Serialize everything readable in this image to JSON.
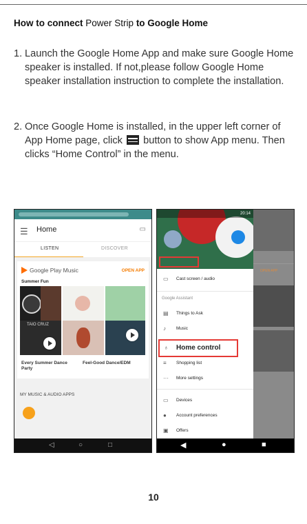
{
  "heading": {
    "prefix": "How to connect",
    "device": "Power Strip",
    "suffix": "to Google Home"
  },
  "steps": [
    {
      "num": "1.",
      "text": "Launch the Google Home App and make sure Google Home speaker is installed. If not,please follow Google Home speaker installation instruction to complete the installation."
    },
    {
      "num": "2.",
      "text_before": "Once Google Home is installed, in the upper left corner of App Home page, click",
      "icon": "menu-icon",
      "text_after": "button to show App menu. Then clicks “Home Control” in the menu."
    }
  ],
  "screenshot_home": {
    "title": "Home",
    "tabs": [
      "LISTEN",
      "DISCOVER"
    ],
    "card_title": "Google Play Music",
    "open_app": "OPEN APP",
    "section": "Summer Fun",
    "album_text_1": "TAIO CRUZ",
    "captions": [
      "Every Summer Dance Party",
      "Feel-Good Dance/EDM"
    ],
    "my_music": "MY MUSIC & AUDIO APPS"
  },
  "screenshot_menu": {
    "status_time": "20:14",
    "bg_open_app": "OPEN APP",
    "items_top": [
      {
        "icon": "cast-icon",
        "label": "Cast screen / audio"
      }
    ],
    "section": "Google Assistant",
    "items_assistant": [
      {
        "icon": "things-icon",
        "label": "Things to Ask"
      },
      {
        "icon": "music-icon",
        "label": "Music"
      }
    ],
    "highlighted": {
      "icon": "bulb-icon",
      "label": "Home control"
    },
    "items_more": [
      {
        "icon": "list-icon",
        "label": "Shopping list"
      },
      {
        "icon": "more-icon",
        "label": "More settings"
      }
    ],
    "items_bottom": [
      {
        "icon": "devices-icon",
        "label": "Devices"
      },
      {
        "icon": "account-icon",
        "label": "Account preferences"
      },
      {
        "icon": "offers-icon",
        "label": "Offers"
      }
    ]
  },
  "page_number": "10"
}
